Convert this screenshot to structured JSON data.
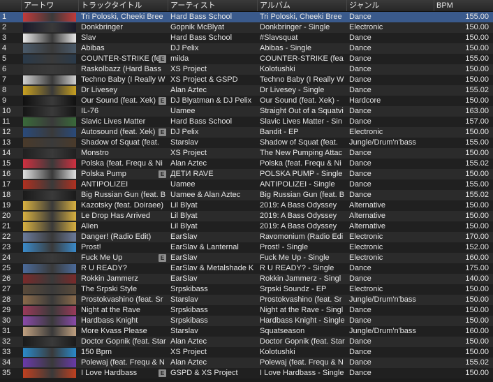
{
  "headers": {
    "art": "アートワ",
    "title": "トラックタイトル",
    "artist": "アーティスト",
    "album": "アルバム",
    "genre": "ジャンル",
    "bpm": "BPM"
  },
  "selected_row": 1,
  "rows": [
    {
      "num": "1",
      "title": "Tri Poloski, Cheeki Bree",
      "explicit": false,
      "artist": "Hard Bass School",
      "album": "Tri Poloski, Cheeki Bree",
      "genre": "Dance",
      "bpm": "155.00",
      "art": "#c13a3a"
    },
    {
      "num": "2",
      "title": "Donkbringer",
      "explicit": false,
      "artist": "Gopnik McBlyat",
      "album": "Donkbringer - Single",
      "genre": "Electronic",
      "bpm": "150.00",
      "art": "#1a1a2a"
    },
    {
      "num": "3",
      "title": "Slav",
      "explicit": false,
      "artist": "Hard Bass School",
      "album": "#Slavsquat",
      "genre": "Dance",
      "bpm": "150.00",
      "art": "#e8e8e8"
    },
    {
      "num": "4",
      "title": "Abibas",
      "explicit": false,
      "artist": "DJ Pelix",
      "album": "Abibas - Single",
      "genre": "Dance",
      "bpm": "150.00",
      "art": "#4a5a6a"
    },
    {
      "num": "5",
      "title": "COUNTER-STRIKE (fe",
      "explicit": true,
      "artist": "milda",
      "album": "COUNTER-STRIKE (fea",
      "genre": "Dance",
      "bpm": "155.00",
      "art": "#2a3a4a"
    },
    {
      "num": "6",
      "title": "Raskolbazz (Hard Bass",
      "explicit": false,
      "artist": "XS Project",
      "album": "Kolotushki",
      "genre": "Dance",
      "bpm": "150.00",
      "art": "#333333"
    },
    {
      "num": "7",
      "title": "Techno Baby (I Really W",
      "explicit": false,
      "artist": "XS Project & GSPD",
      "album": "Techno Baby (I Really W",
      "genre": "Dance",
      "bpm": "150.00",
      "art": "#d0d0d0"
    },
    {
      "num": "8",
      "title": "Dr Livesey",
      "explicit": false,
      "artist": "Alan Aztec",
      "album": "Dr Livesey - Single",
      "genre": "Dance",
      "bpm": "155.02",
      "art": "#c8a020"
    },
    {
      "num": "9",
      "title": "Our Sound (feat. Xek)",
      "explicit": true,
      "artist": "DJ Blyatman & DJ Pelix",
      "album": "Our Sound (feat. Xek) -",
      "genre": "Hardcore",
      "bpm": "150.00",
      "art": "#101010"
    },
    {
      "num": "10",
      "title": "IL-76",
      "explicit": false,
      "artist": "Uamee",
      "album": "Straight Out of a Squatvi",
      "genre": "Dance",
      "bpm": "163.00",
      "art": "#151515"
    },
    {
      "num": "11",
      "title": "Slavic Lives Matter",
      "explicit": false,
      "artist": "Hard Bass School",
      "album": "Slavic Lives Matter - Sin",
      "genre": "Dance",
      "bpm": "157.00",
      "art": "#3a6a3a"
    },
    {
      "num": "12",
      "title": "Autosound (feat. Xek)",
      "explicit": true,
      "artist": "DJ Pelix",
      "album": "Bandit - EP",
      "genre": "Electronic",
      "bpm": "150.00",
      "art": "#2a4a7a"
    },
    {
      "num": "13",
      "title": "Shadow of Squat (feat.",
      "explicit": false,
      "artist": "Starslav",
      "album": "Shadow of Squat (feat.",
      "genre": "Jungle/Drum'n'bass",
      "bpm": "155.00",
      "art": "#4a3a2a"
    },
    {
      "num": "14",
      "title": "Monstro",
      "explicit": false,
      "artist": "XS Project",
      "album": "The New Pumping Attac",
      "genre": "Dance",
      "bpm": "150.00",
      "art": "#202020"
    },
    {
      "num": "15",
      "title": "Polska (feat. Frequ & Ni",
      "explicit": false,
      "artist": "Alan Aztec",
      "album": "Polska (feat. Frequ & Ni",
      "genre": "Dance",
      "bpm": "155.02",
      "art": "#d03040"
    },
    {
      "num": "16",
      "title": "Polska Pump",
      "explicit": true,
      "artist": "ДЕТИ RAVE",
      "album": "POLSKA PUMP - Single",
      "genre": "Dance",
      "bpm": "150.00",
      "art": "#e0e0e0"
    },
    {
      "num": "17",
      "title": "ANTIPOLIZEI",
      "explicit": false,
      "artist": "Uamee",
      "album": "ANTIPOLIZEI - Single",
      "genre": "Dance",
      "bpm": "155.00",
      "art": "#b03020"
    },
    {
      "num": "18",
      "title": "Big Russian Gun (feat. B",
      "explicit": false,
      "artist": "Uamee & Alan Aztec",
      "album": "Big Russian Gun (feat. B",
      "genre": "Dance",
      "bpm": "155.02",
      "art": "#1a1a1a"
    },
    {
      "num": "19",
      "title": "Kazotsky (feat. Doiraee)",
      "explicit": false,
      "artist": "Lil Blyat",
      "album": "2019: A Bass Odyssey",
      "genre": "Alternative",
      "bpm": "150.00",
      "art": "#d8b040"
    },
    {
      "num": "20",
      "title": "Le Drop Has Arrived",
      "explicit": false,
      "artist": "Lil Blyat",
      "album": "2019: A Bass Odyssey",
      "genre": "Alternative",
      "bpm": "150.00",
      "art": "#d8b040"
    },
    {
      "num": "21",
      "title": "Alien",
      "explicit": false,
      "artist": "Lil Blyat",
      "album": "2019: A Bass Odyssey",
      "genre": "Alternative",
      "bpm": "150.00",
      "art": "#d8b040"
    },
    {
      "num": "22",
      "title": "Danger! (Radio Edit)",
      "explicit": false,
      "artist": "EarSlav",
      "album": "Ravomonium (Radio Edi",
      "genre": "Electronic",
      "bpm": "170.00",
      "art": "#6a7a9a"
    },
    {
      "num": "23",
      "title": "Prost!",
      "explicit": false,
      "artist": "EarSlav & Lanternal",
      "album": "Prost! - Single",
      "genre": "Electronic",
      "bpm": "152.00",
      "art": "#3a8aca"
    },
    {
      "num": "24",
      "title": "Fuck Me Up",
      "explicit": true,
      "artist": "EarSlav",
      "album": "Fuck Me Up - Single",
      "genre": "Electronic",
      "bpm": "160.00",
      "art": "#2a2a2a"
    },
    {
      "num": "25",
      "title": "R U READY?",
      "explicit": false,
      "artist": "EarSlav & Metalshade K",
      "album": "R U READY? - Single",
      "genre": "Dance",
      "bpm": "175.00",
      "art": "#4a6a9a"
    },
    {
      "num": "26",
      "title": "Rokkin Jammerz",
      "explicit": false,
      "artist": "EarSlav",
      "album": "Rokkin Jammerz - Singl",
      "genre": "Dance",
      "bpm": "140.00",
      "art": "#7a2a2a"
    },
    {
      "num": "27",
      "title": "The Srpski Style",
      "explicit": false,
      "artist": "Srpskibass",
      "album": "Srpski Soundz - EP",
      "genre": "Electronic",
      "bpm": "150.00",
      "art": "#5a4a3a"
    },
    {
      "num": "28",
      "title": "Prostokvashino (feat. Sr",
      "explicit": false,
      "artist": "Starslav",
      "album": "Prostokvashino (feat. Sr",
      "genre": "Jungle/Drum'n'bass",
      "bpm": "150.00",
      "art": "#8a6a4a"
    },
    {
      "num": "29",
      "title": "Night at the Rave",
      "explicit": false,
      "artist": "Srpskibass",
      "album": "Night at the Rave - Singl",
      "genre": "Dance",
      "bpm": "150.00",
      "art": "#9a3a5a"
    },
    {
      "num": "30",
      "title": "Hardbass Knight",
      "explicit": false,
      "artist": "Srpskibass",
      "album": "Hardbass Knight - Single",
      "genre": "Dance",
      "bpm": "150.00",
      "art": "#8a4aaa"
    },
    {
      "num": "31",
      "title": "More Kvass Please",
      "explicit": false,
      "artist": "Starslav",
      "album": "Squatseason",
      "genre": "Jungle/Drum'n'bass",
      "bpm": "160.00",
      "art": "#c0a080"
    },
    {
      "num": "32",
      "title": "Doctor Gopnik (feat. Star",
      "explicit": false,
      "artist": "Alan Aztec",
      "album": "Doctor Gopnik (feat. Star",
      "genre": "Dance",
      "bpm": "150.00",
      "art": "#1a1a1a"
    },
    {
      "num": "33",
      "title": "150 Bpm",
      "explicit": false,
      "artist": "XS Project",
      "album": "Kolotushki",
      "genre": "Dance",
      "bpm": "150.00",
      "art": "#2a8aca"
    },
    {
      "num": "34",
      "title": "Polewaj (feat. Frequ & N",
      "explicit": false,
      "artist": "Alan Aztec",
      "album": "Polewaj (feat. Frequ & N",
      "genre": "Dance",
      "bpm": "155.02",
      "art": "#6a3aaa"
    },
    {
      "num": "35",
      "title": "I Love Hardbass",
      "explicit": true,
      "artist": "GSPD & XS Project",
      "album": "I Love Hardbass - Single",
      "genre": "Dance",
      "bpm": "150.00",
      "art": "#c04020"
    }
  ]
}
